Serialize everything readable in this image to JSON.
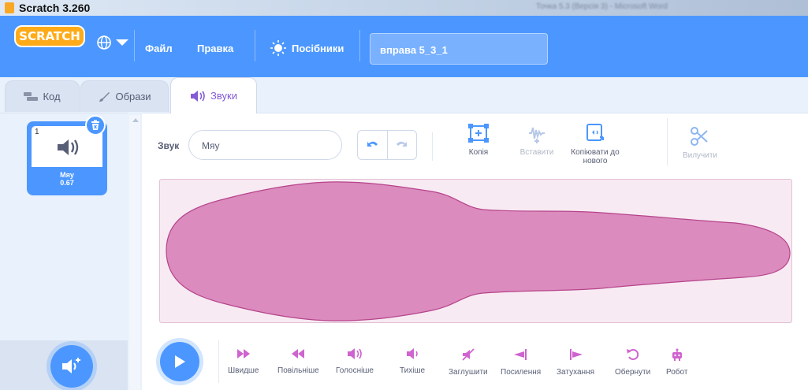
{
  "window": {
    "title": "Scratch 3.260",
    "blurred_title": "Точка 5.3 (Версія 3) - Microsoft Word"
  },
  "menubar": {
    "logo": "SCRATCH",
    "file": "Файл",
    "edit": "Правка",
    "tutorials": "Посібники",
    "project_title": "вправа 5_3_1"
  },
  "tabs": {
    "code": "Код",
    "costumes": "Образи",
    "sounds": "Звуки"
  },
  "sound_list": [
    {
      "index": "1",
      "name": "Мяу",
      "duration": "0.67"
    }
  ],
  "editor": {
    "sound_label": "Звук",
    "sound_name": "Мяу",
    "tools": {
      "copy": "Копія",
      "paste": "Вставити",
      "copy_to_new": "Копіювати до нового",
      "delete": "Вилучити"
    }
  },
  "effects": [
    {
      "label": "Швидше",
      "icon": "faster-icon"
    },
    {
      "label": "Повільніше",
      "icon": "slower-icon"
    },
    {
      "label": "Голосніше",
      "icon": "louder-icon"
    },
    {
      "label": "Тихіше",
      "icon": "softer-icon"
    },
    {
      "label": "Заглушити",
      "icon": "mute-icon"
    },
    {
      "label": "Посилення",
      "icon": "fade-in-icon"
    },
    {
      "label": "Затухання",
      "icon": "fade-out-icon"
    },
    {
      "label": "Обернути",
      "icon": "reverse-icon"
    },
    {
      "label": "Робот",
      "icon": "robot-icon"
    }
  ],
  "colors": {
    "menubar": "#4c97ff",
    "accent_purple": "#855cd6",
    "waveform": "#cf63a6"
  }
}
